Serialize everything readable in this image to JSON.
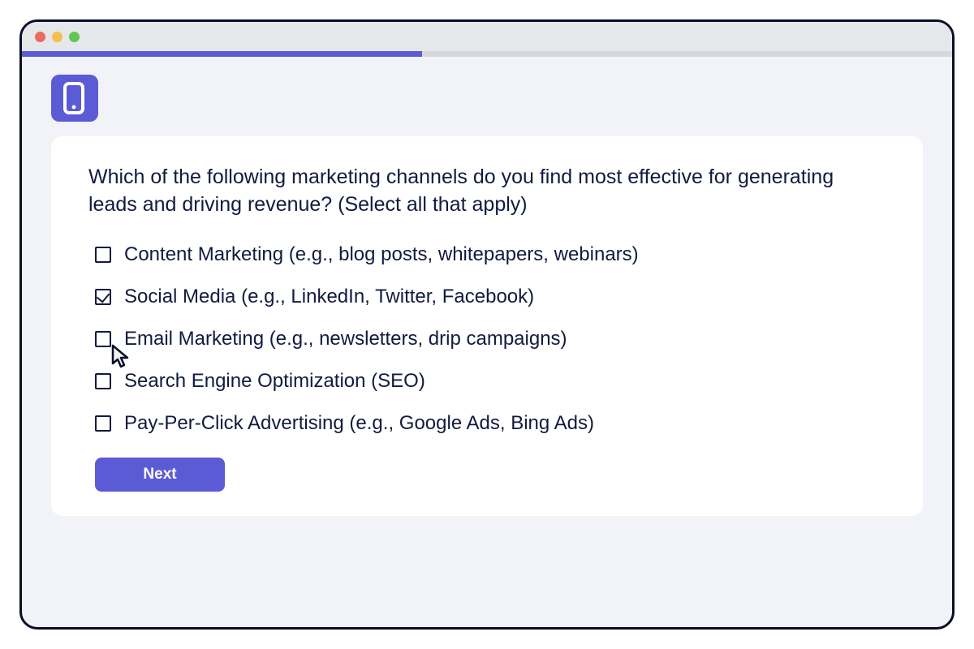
{
  "colors": {
    "accent": "#5b5bd6",
    "text": "#111b3f",
    "window_bg": "#f1f3f8",
    "card_bg": "#ffffff"
  },
  "progress": {
    "percent": 43
  },
  "logo": {
    "icon": "phone-icon"
  },
  "question": "Which of the following marketing channels do you find most effective for generating leads and driving revenue? (Select all that apply)",
  "options": [
    {
      "label": "Content Marketing (e.g., blog posts, whitepapers, webinars)",
      "checked": false
    },
    {
      "label": "Social Media (e.g., LinkedIn, Twitter, Facebook)",
      "checked": true
    },
    {
      "label": "Email Marketing (e.g., newsletters, drip campaigns)",
      "checked": false
    },
    {
      "label": "Search Engine Optimization (SEO)",
      "checked": false
    },
    {
      "label": "Pay-Per-Click Advertising (e.g., Google Ads, Bing Ads)",
      "checked": false
    }
  ],
  "buttons": {
    "next": "Next"
  }
}
